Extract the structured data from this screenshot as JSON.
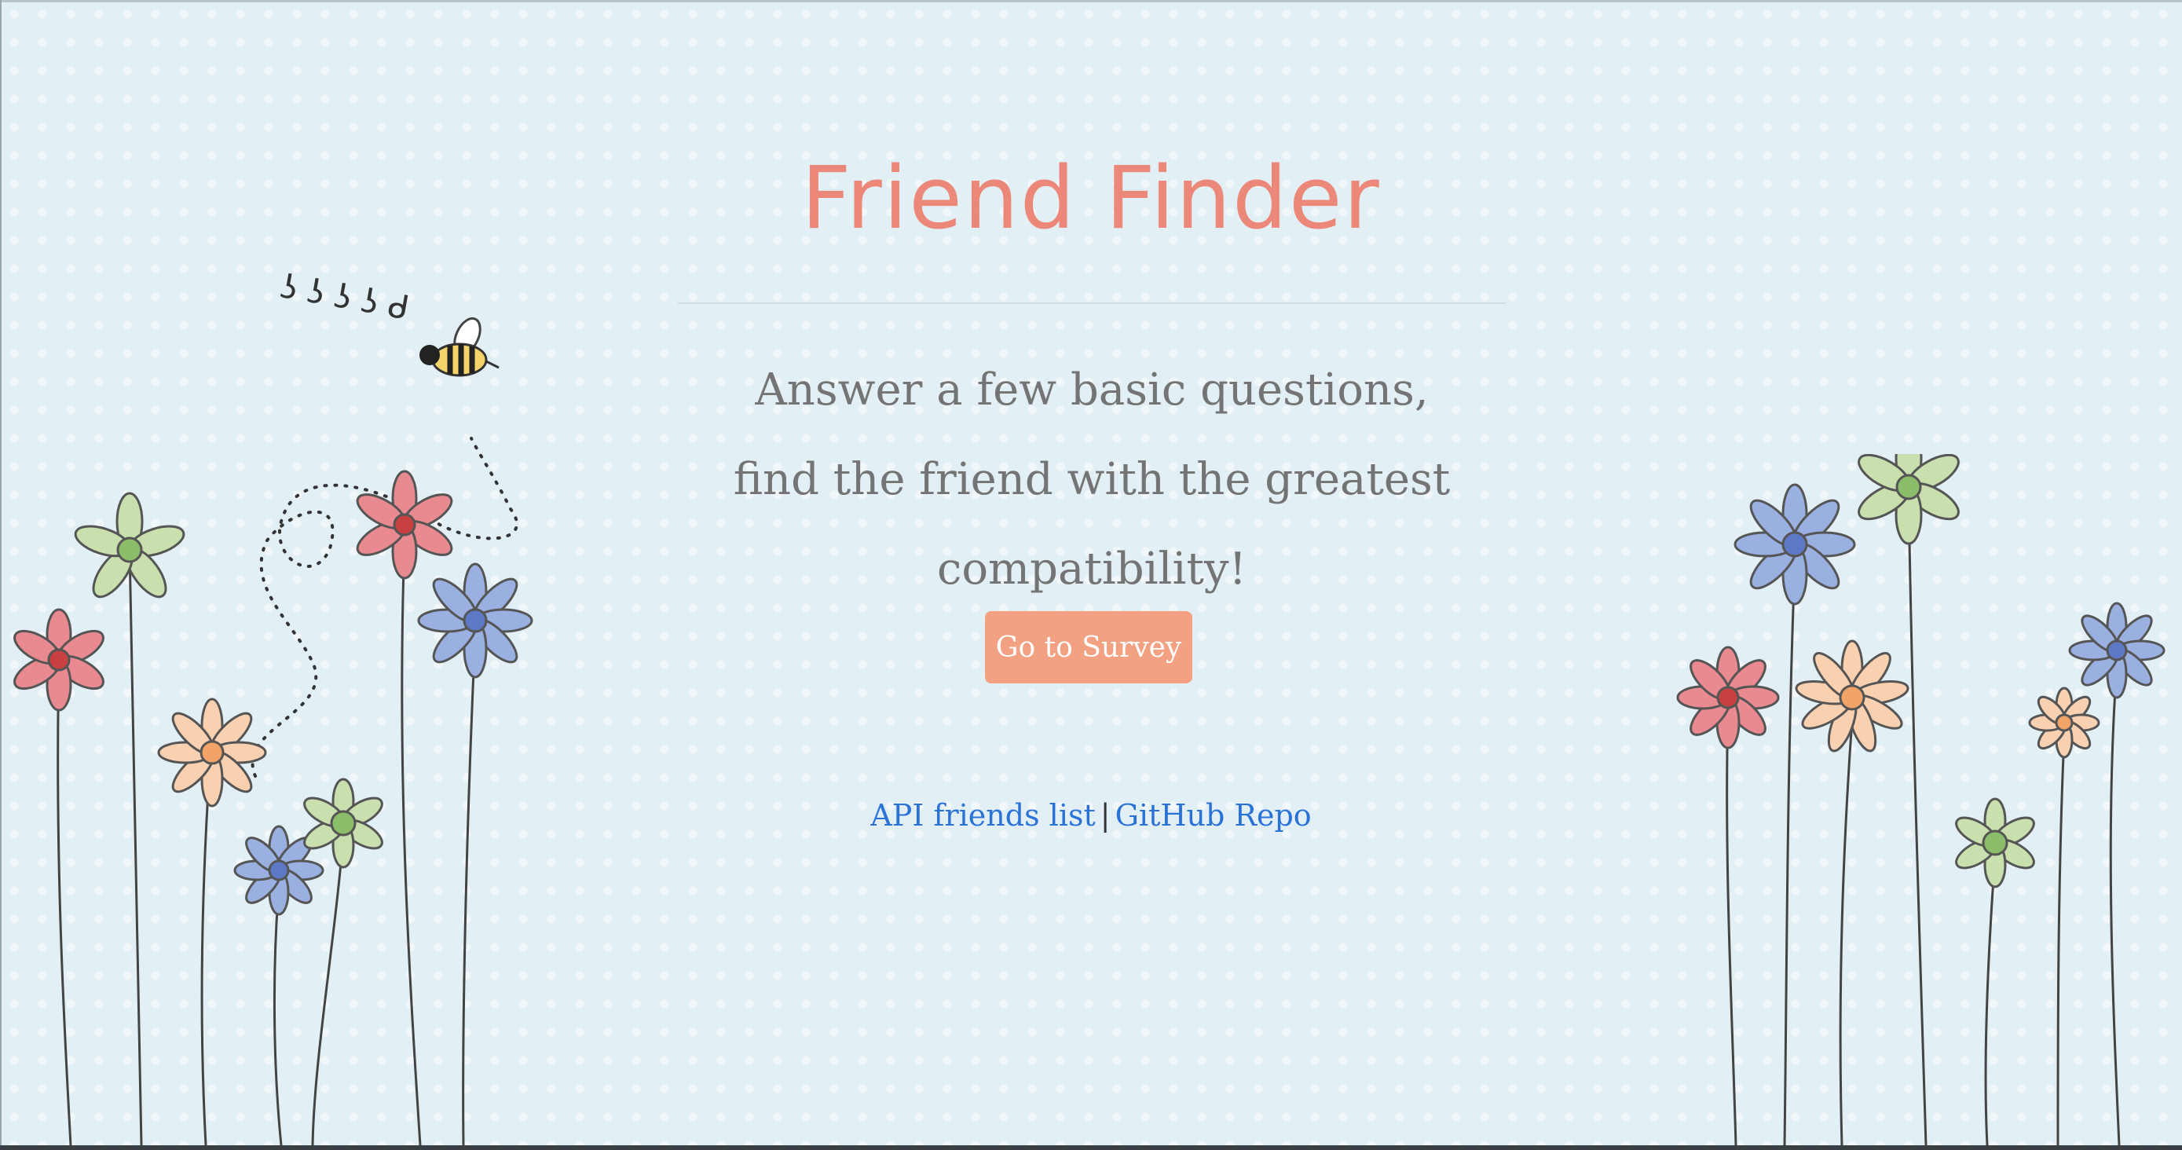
{
  "page": {
    "title": "Friend Finder",
    "tagline": "Answer a few basic questions, find the friend with the greatest compatibility!",
    "survey_button": "Go to Survey",
    "links": {
      "api": "API friends list",
      "separator": "|",
      "github": "GitHub Repo"
    }
  },
  "decoration": {
    "bee_buzz_text": "ʖ ʖ ʖ ʖ ᑯ",
    "flower_colors": [
      "#e88a8f",
      "#b9d6a0",
      "#f7c19c",
      "#8ea6dc"
    ],
    "background": "#e2f0f5",
    "accent": "#ec8879",
    "button_color": "#f2a282",
    "link_color": "#2a72d8"
  }
}
